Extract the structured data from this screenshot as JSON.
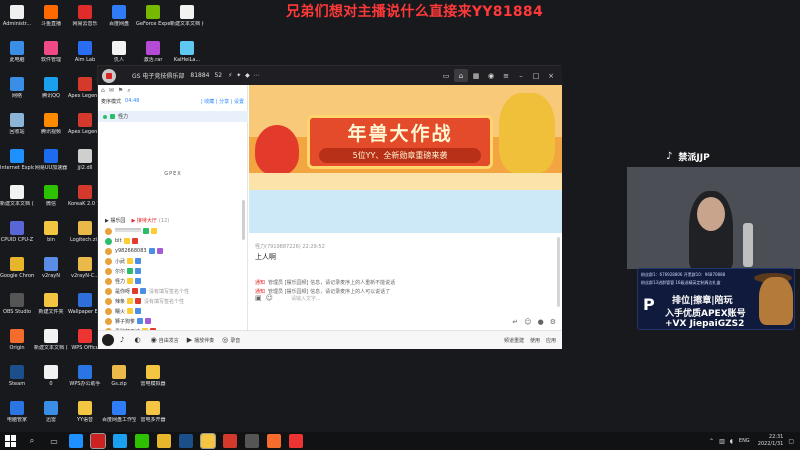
{
  "banner_text": "兄弟们想对主播说什么直接来YY81884",
  "desktop_icons": [
    {
      "label": "Administr...",
      "color": "#f0f0f0",
      "col": 0,
      "row": 0
    },
    {
      "label": "斗鱼直播",
      "color": "#ff6a00",
      "col": 1,
      "row": 0
    },
    {
      "label": "网易云音乐",
      "color": "#e02b2b",
      "col": 2,
      "row": 0
    },
    {
      "label": "百度网盘",
      "color": "#2e7cf6",
      "col": 3,
      "row": 0
    },
    {
      "label": "GeForce Experience",
      "color": "#76b900",
      "col": 4,
      "row": 0
    },
    {
      "label": "新建文本文档 (4)",
      "color": "#f2f2f2",
      "col": 5,
      "row": 0
    },
    {
      "label": "此电脑",
      "color": "#3a8ee6",
      "col": 0,
      "row": 1
    },
    {
      "label": "软件管理",
      "color": "#f04a86",
      "col": 1,
      "row": 1
    },
    {
      "label": "Aim Lab",
      "color": "#2a6df4",
      "col": 2,
      "row": 1
    },
    {
      "label": "仇人",
      "color": "#f2f2f2",
      "col": 3,
      "row": 1
    },
    {
      "label": "激活.rar",
      "color": "#b54ad6",
      "col": 4,
      "row": 1
    },
    {
      "label": "KaiHeiLa...",
      "color": "#5ec8f0",
      "col": 5,
      "row": 1
    },
    {
      "label": "网络",
      "color": "#3a8ee6",
      "col": 0,
      "row": 2
    },
    {
      "label": "腾讯QQ",
      "color": "#1aa0ee",
      "col": 1,
      "row": 2
    },
    {
      "label": "Apex Legends",
      "color": "#d33a2c",
      "col": 2,
      "row": 2
    },
    {
      "label": "回收站",
      "color": "#8ab4d8",
      "col": 0,
      "row": 3
    },
    {
      "label": "腾讯视频",
      "color": "#ff8a00",
      "col": 1,
      "row": 3
    },
    {
      "label": "Apex Legends",
      "color": "#d33a2c",
      "col": 2,
      "row": 3
    },
    {
      "label": "Internet Explorer",
      "color": "#1e90ff",
      "col": 0,
      "row": 4
    },
    {
      "label": "网易UU加速器",
      "color": "#1d6cf0",
      "col": 1,
      "row": 4
    },
    {
      "label": "jjl2.dll",
      "color": "#cfcfcf",
      "col": 2,
      "row": 4
    },
    {
      "label": "新建文本文档 (2)",
      "color": "#f2f2f2",
      "col": 0,
      "row": 5
    },
    {
      "label": "微信",
      "color": "#2dc100",
      "col": 1,
      "row": 5
    },
    {
      "label": "KoreaK 2.0 The Meta",
      "color": "#d33a2c",
      "col": 2,
      "row": 5
    },
    {
      "label": "CPUID CPU-Z",
      "color": "#5a66d6",
      "col": 0,
      "row": 6
    },
    {
      "label": "bin",
      "color": "#f4c542",
      "col": 1,
      "row": 6
    },
    {
      "label": "Logitech.zip",
      "color": "#e9b949",
      "col": 2,
      "row": 6
    },
    {
      "label": "Google Chrome",
      "color": "#e7b52b",
      "col": 0,
      "row": 7
    },
    {
      "label": "v2rayN",
      "color": "#5a8de6",
      "col": 1,
      "row": 7
    },
    {
      "label": "v2rayN-C...",
      "color": "#e9b949",
      "col": 2,
      "row": 7
    },
    {
      "label": "OBS Studio",
      "color": "#555555",
      "col": 0,
      "row": 8
    },
    {
      "label": "新建文件夹",
      "color": "#f4c542",
      "col": 1,
      "row": 8
    },
    {
      "label": "Wallpaper Engine:...",
      "color": "#2e6fd9",
      "col": 2,
      "row": 8
    },
    {
      "label": "Origin",
      "color": "#f56c2d",
      "col": 0,
      "row": 9
    },
    {
      "label": "新建文本文档 (2)",
      "color": "#f2f2f2",
      "col": 1,
      "row": 9
    },
    {
      "label": "WPS Office",
      "color": "#e33",
      "col": 2,
      "row": 9
    },
    {
      "label": "Steam",
      "color": "#1b4f8a",
      "col": 0,
      "row": 10
    },
    {
      "label": "0",
      "color": "#f2f2f2",
      "col": 1,
      "row": 10
    },
    {
      "label": "WPS办公助手",
      "color": "#2a75e3",
      "col": 2,
      "row": 10
    },
    {
      "label": "Gs.zip",
      "color": "#e9b949",
      "col": 3,
      "row": 10
    },
    {
      "label": "雷电模拟器",
      "color": "#f4c542",
      "col": 4,
      "row": 10
    },
    {
      "label": "电脑管家",
      "color": "#2a75e3",
      "col": 0,
      "row": 11
    },
    {
      "label": "迅雷",
      "color": "#3a8ee6",
      "col": 1,
      "row": 11
    },
    {
      "label": "YY语音",
      "color": "#f4c542",
      "col": 2,
      "row": 11
    },
    {
      "label": "百度网盘工作空间",
      "color": "#2e7cf6",
      "col": 3,
      "row": 11
    },
    {
      "label": "雷电多开器",
      "color": "#f4c542",
      "col": 4,
      "row": 11
    }
  ],
  "app": {
    "title": "GS 电子竞技俱乐部",
    "channel_id": "81884",
    "user_count": "52",
    "title_glyphs": "⚡ ✦ ◆ ⋯",
    "toolbar_icons": [
      "⌂",
      "✉",
      "⚑",
      "⌕"
    ],
    "channel_mode": "麦序模式",
    "channel_time": "04:48",
    "channel_links": "| 收藏 | 分享 | 设置",
    "current_channel": "怪力",
    "section_title": "GPEX",
    "list_header": "▶ 摆乐园",
    "list_sub": "▶ 接待大厅",
    "list_count": "(12)",
    "members": [
      {
        "name": "!!!!!!!!!!!!!",
        "note": "",
        "av": "#e8a23a",
        "b1": "#2bbd6a",
        "b2": "#ffcc33"
      },
      {
        "name": "blt",
        "note": "",
        "av": "#2bbd6a",
        "b1": "#ffcc33",
        "b2": "#e23b2c"
      },
      {
        "name": "y982668083",
        "note": "",
        "av": "#e8a23a",
        "b1": "#4a90e2",
        "b2": "#a65bd6"
      },
      {
        "name": "小武",
        "note": "",
        "av": "#e8a23a",
        "b1": "#ffcc33",
        "b2": "#4a90e2"
      },
      {
        "name": "尔尔",
        "note": "",
        "av": "#e8a23a",
        "b1": "#2bbd6a",
        "b2": "#4a90e2"
      },
      {
        "name": "怪力",
        "note": "",
        "av": "#e8a23a",
        "b1": "#ffcc33",
        "b2": "#4a90e2"
      },
      {
        "name": "是你呀",
        "note": "没有填写签名个性",
        "av": "#e8a23a",
        "b1": "#e23b2c",
        "b2": "#4a90e2"
      },
      {
        "name": "辣条",
        "note": "没有填写签名个性",
        "av": "#e8a23a",
        "b1": "#ffcc33",
        "b2": "#e23b2c"
      },
      {
        "name": "糯火",
        "note": "",
        "av": "#e8a23a",
        "b1": "#ffcc33",
        "b2": "#4a90e2"
      },
      {
        "name": "狮子狗爹",
        "note": "",
        "av": "#e8a23a",
        "b1": "#4a90e2",
        "b2": "#a65bd6"
      },
      {
        "name": "看醉打不过",
        "note": "",
        "av": "#e8a23a",
        "b1": "#ffcc33",
        "b2": "#e23b2c"
      },
      {
        "name": "猫小悟",
        "note": "",
        "av": "#e8a23a",
        "b1": "#4a90e2",
        "b2": "#a65bd6"
      }
    ],
    "promo_title": "年兽大作战",
    "promo_sub": "5位YY、全新勋章重磅来袭",
    "chat_meta": "怪力(7919887226)  22:29:52",
    "chat_text": "上人啊",
    "notice_1_tag": "通知",
    "notice_1_text": "管理员 [摆乐园频] 信息，请记录麦序上的人重新不能说话",
    "notice_2_tag": "通知",
    "notice_2_text": "管理员 [摆乐园频] 信息，请记录麦序上的人可以说话了",
    "input_placeholder": "请输入文字...",
    "bottombar": {
      "item1": "自由发言",
      "item2": "播放伴奏",
      "item3": "录音",
      "right1": "频道重建",
      "right2": "使用",
      "right3": "应用"
    }
  },
  "webcam": {
    "brand_icon": "tiktok-icon",
    "brand_name": "禁派JJP"
  },
  "ad": {
    "topline": "粉丝群1：676928806  开黑群10：96870888",
    "topline2": "粉丝群13进群管管   16级送精英定制周边礼盒",
    "logo": "P",
    "line1": "排位|擦章|陪玩",
    "line2": "入手优质APEX账号",
    "line3": "+VX JiepaiGZS2"
  },
  "taskbar": {
    "lang": "ENG",
    "time": "22:31",
    "date": "2022/1/31"
  }
}
